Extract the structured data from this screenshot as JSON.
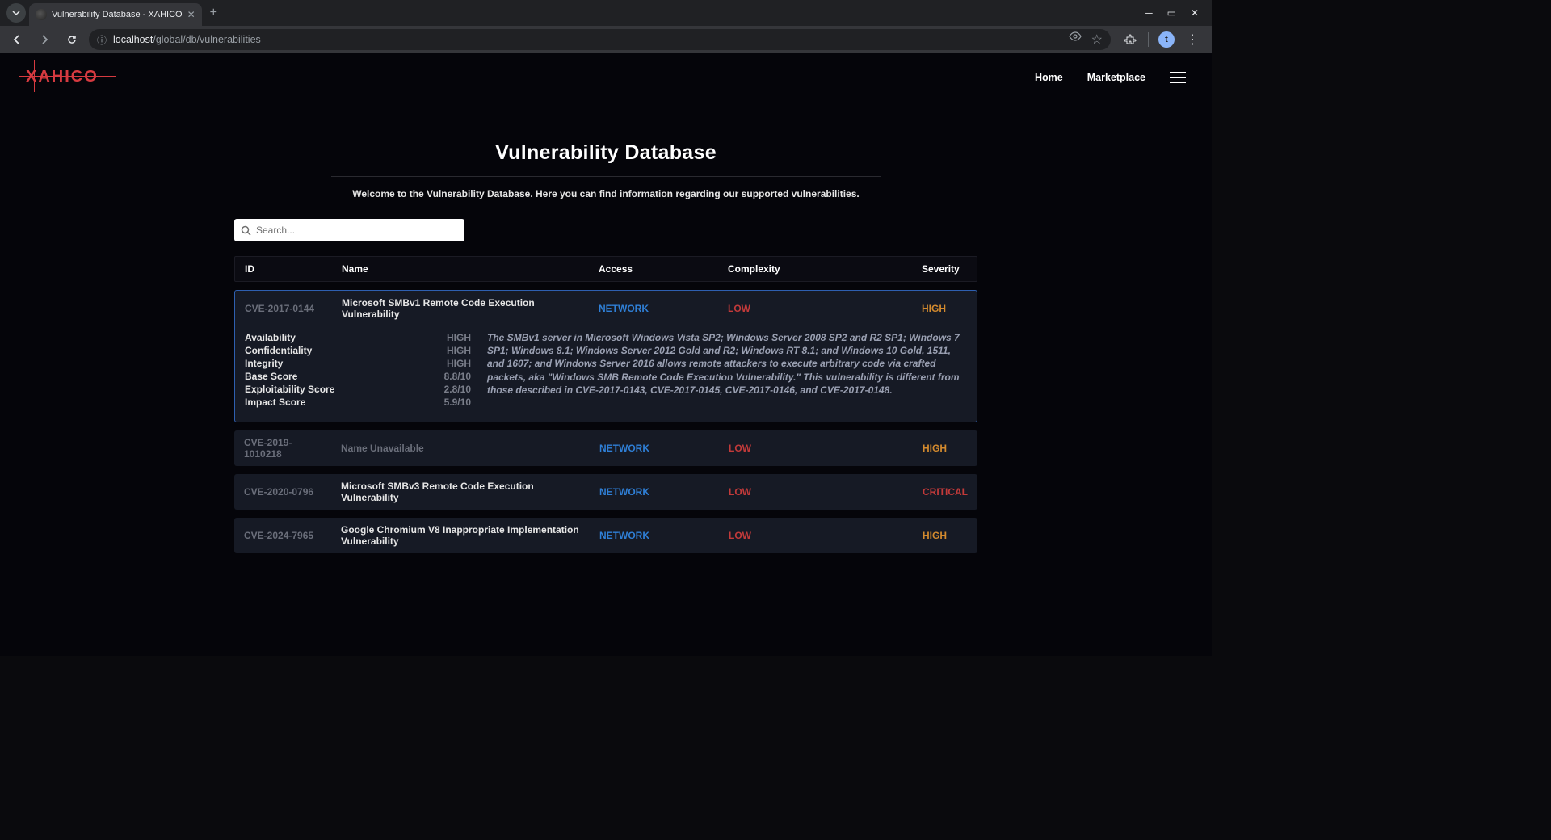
{
  "browser": {
    "tab_title": "Vulnerability Database - XAHICO",
    "url_host": "localhost",
    "url_path": "/global/db/vulnerabilities",
    "avatar_letter": "t"
  },
  "header": {
    "logo_text": "XAHICO",
    "nav": {
      "home": "Home",
      "marketplace": "Marketplace"
    }
  },
  "page": {
    "title": "Vulnerability Database",
    "welcome": "Welcome to the Vulnerability Database. Here you can find information regarding our supported vulnerabilities.",
    "search_placeholder": "Search..."
  },
  "columns": {
    "id": "ID",
    "name": "Name",
    "access": "Access",
    "complexity": "Complexity",
    "severity": "Severity"
  },
  "rows": [
    {
      "id": "CVE-2017-0144",
      "name": "Microsoft SMBv1 Remote Code Execution Vulnerability",
      "access": "NETWORK",
      "complexity": "LOW",
      "severity": "HIGH",
      "expanded": true,
      "metrics": {
        "availability": {
          "k": "Availability",
          "v": "HIGH"
        },
        "confidentiality": {
          "k": "Confidentiality",
          "v": "HIGH"
        },
        "integrity": {
          "k": "Integrity",
          "v": "HIGH"
        },
        "base_score": {
          "k": "Base Score",
          "v": "8.8/10"
        },
        "exploitability": {
          "k": "Exploitability Score",
          "v": "2.8/10"
        },
        "impact": {
          "k": "Impact Score",
          "v": "5.9/10"
        }
      },
      "description": "The SMBv1 server in Microsoft Windows Vista SP2; Windows Server 2008 SP2 and R2 SP1; Windows 7 SP1; Windows 8.1; Windows Server 2012 Gold and R2; Windows RT 8.1; and Windows 10 Gold, 1511, and 1607; and Windows Server 2016 allows remote attackers to execute arbitrary code via crafted packets, aka \"Windows SMB Remote Code Execution Vulnerability.\" This vulnerability is different from those described in CVE-2017-0143, CVE-2017-0145, CVE-2017-0146, and CVE-2017-0148."
    },
    {
      "id": "CVE-2019-1010218",
      "name": "Name Unavailable",
      "name_unavailable": true,
      "access": "NETWORK",
      "complexity": "LOW",
      "severity": "HIGH"
    },
    {
      "id": "CVE-2020-0796",
      "name": "Microsoft SMBv3 Remote Code Execution Vulnerability",
      "access": "NETWORK",
      "complexity": "LOW",
      "severity": "CRITICAL"
    },
    {
      "id": "CVE-2024-7965",
      "name": "Google Chromium V8 Inappropriate Implementation Vulnerability",
      "access": "NETWORK",
      "complexity": "LOW",
      "severity": "HIGH"
    }
  ]
}
